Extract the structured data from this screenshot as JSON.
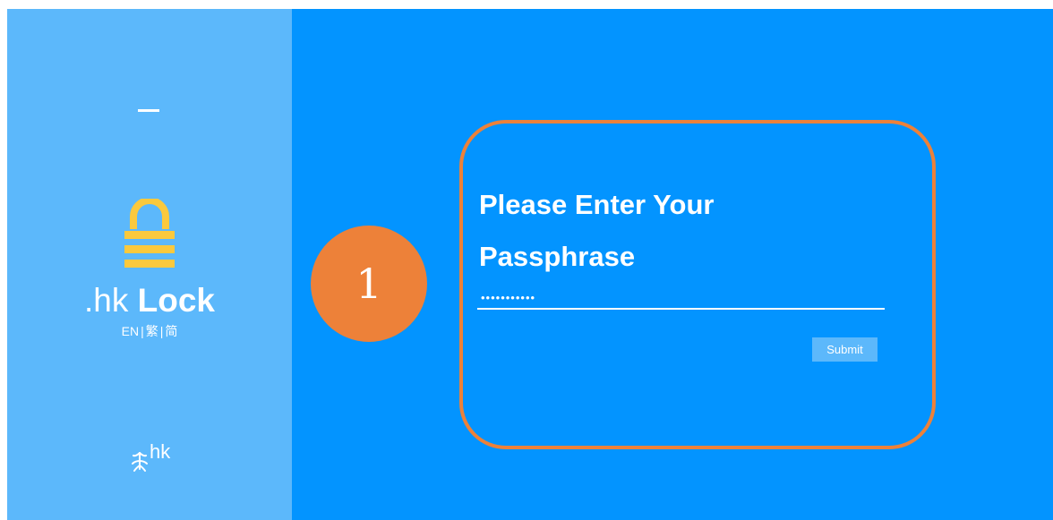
{
  "sidebar": {
    "menu_icon": "hamburger-menu-icon",
    "lock_icon": "lock-icon",
    "logo_prefix": ".hk",
    "logo_bold": "Lock",
    "languages": [
      "EN",
      "繁",
      "简"
    ],
    "separator": "|",
    "brand_text": "hk",
    "brand_icon": "dot-hk-brand-icon"
  },
  "main": {
    "step_number": "1",
    "title": "Please Enter Your Passphrase",
    "passphrase_value": "•••••••••••",
    "submit_label": "Submit"
  },
  "colors": {
    "sidebar_bg": "#5cb8fb",
    "main_bg": "#0394ff",
    "accent_orange": "#ed8139",
    "lock_yellow": "#fbc93d"
  }
}
